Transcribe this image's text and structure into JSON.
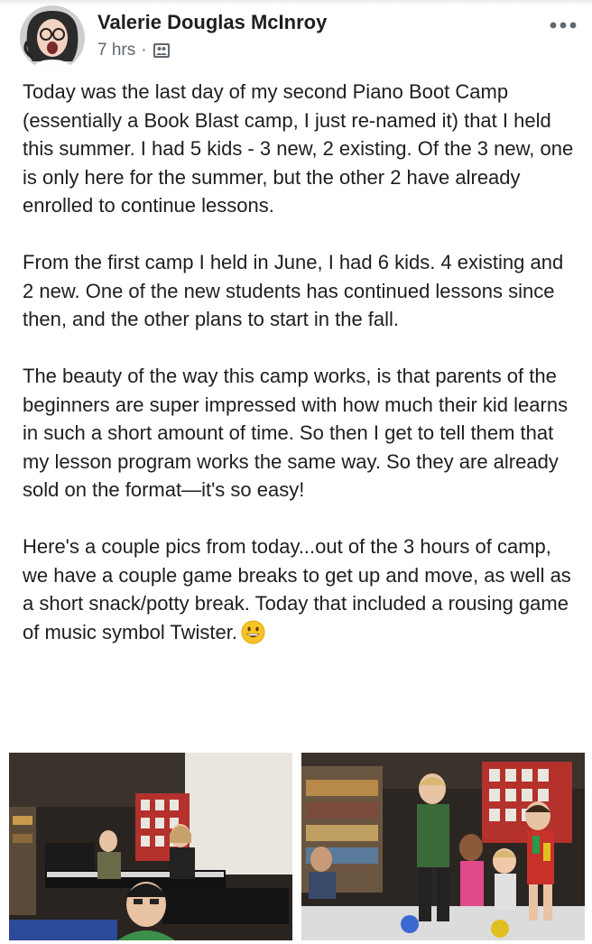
{
  "post": {
    "author": "Valerie Douglas McInroy",
    "time": "7 hrs",
    "separator": "·",
    "audience_icon": "group-audience-icon",
    "more_icon": "more-horizontal-icon",
    "paragraphs": [
      "Today was the last day of my second Piano Boot Camp (essentially a Book Blast camp, I just re-named it) that I held this summer. I had 5 kids - 3 new, 2 existing. Of the 3 new, one is only here for the summer, but the other 2 have already enrolled to continue lessons.",
      "From the first camp I held in June, I had 6 kids. 4 existing and 2 new. One of the new students has continued lessons since then, and the other plans to start in the fall.",
      "The beauty of the way this camp works, is that parents of the beginners are super impressed with how much their kid learns in such a short amount of time. So then I get to tell them that my lesson program works the same way. So they are already sold on the format—it's so easy!",
      "Here's a couple pics from today...out of the 3 hours of camp, we have a couple game breaks to get up and move, as well as a short snack/potty break. Today that included a rousing game of music symbol Twister."
    ],
    "emoji": "grinning-face-emoji",
    "photos": [
      {
        "name": "piano-lab-photo"
      },
      {
        "name": "twister-game-photo"
      }
    ]
  },
  "colors": {
    "text": "#1c1e21",
    "meta": "#606770",
    "divider": "#e9ebee"
  }
}
